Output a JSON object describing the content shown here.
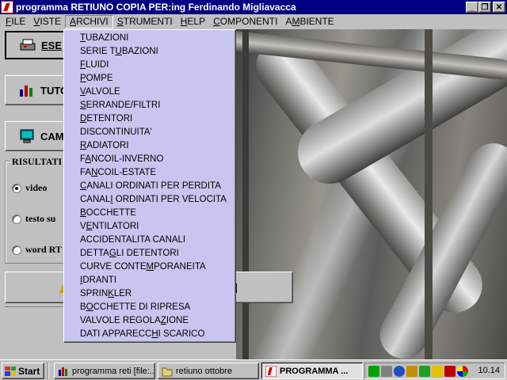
{
  "window": {
    "title": "programma RETIUNO COPIA PER:ing Ferdinando Migliavacca",
    "minimize_label": "_",
    "restore_label": "❐",
    "close_label": "✕"
  },
  "menubar": [
    {
      "label": "FILE",
      "mnemonic": "F",
      "rest": "ILE"
    },
    {
      "label": "VISTE",
      "mnemonic": "V",
      "rest": "ISTE"
    },
    {
      "label": "ARCHIVI",
      "mnemonic": "A",
      "rest": "RCHIVI"
    },
    {
      "label": "STRUMENTI",
      "mnemonic": "S",
      "rest": "TRUMENTI"
    },
    {
      "label": "HELP",
      "mnemonic": "H",
      "rest": "ELP"
    },
    {
      "label": "COMPONENTI",
      "mnemonic": "C",
      "rest": "OMPONENTI"
    },
    {
      "label": "AMBIENTE",
      "mnemonic": "M",
      "pre": "A",
      "rest": "BIENTE"
    }
  ],
  "active_menu": "ARCHIVI",
  "archivi_menu": [
    {
      "pre": "",
      "u": "T",
      "post": "UBAZIONI"
    },
    {
      "pre": "SERIE T",
      "u": "U",
      "post": "BAZIONI"
    },
    {
      "pre": "",
      "u": "F",
      "post": "LUIDI"
    },
    {
      "pre": "",
      "u": "P",
      "post": "OMPE"
    },
    {
      "pre": "",
      "u": "V",
      "post": "ALVOLE"
    },
    {
      "pre": "",
      "u": "S",
      "post": "ERRANDE/FILTRI"
    },
    {
      "pre": "",
      "u": "D",
      "post": "ETENTORI"
    },
    {
      "pre": "DISCONTINUITA'",
      "u": "",
      "post": ""
    },
    {
      "pre": "",
      "u": "R",
      "post": "ADIATORI"
    },
    {
      "pre": "F",
      "u": "A",
      "post": "NCOIL-INVERNO"
    },
    {
      "pre": "FA",
      "u": "N",
      "post": "COIL-ESTATE"
    },
    {
      "pre": "",
      "u": "C",
      "post": "ANALI ORDINATI PER PERDITA"
    },
    {
      "pre": "CANAL",
      "u": "I",
      "post": " ORDINATI PER VELOCITA"
    },
    {
      "pre": "",
      "u": "B",
      "post": "OCCHETTE"
    },
    {
      "pre": "V",
      "u": "E",
      "post": "NTILATORI"
    },
    {
      "pre": "ACCIDENTALITA CANALI",
      "u": "",
      "post": ""
    },
    {
      "pre": "DETTA",
      "u": "G",
      "post": "LI DETENTORI"
    },
    {
      "pre": "CURVE CONTE",
      "u": "M",
      "post": "PORANEITA"
    },
    {
      "pre": "",
      "u": "I",
      "post": "DRANTI"
    },
    {
      "pre": "SPRIN",
      "u": "K",
      "post": "LER"
    },
    {
      "pre": "B",
      "u": "O",
      "post": "CCHETTE DI RIPRESA"
    },
    {
      "pre": "VALVOLE REGOLA",
      "u": "Z",
      "post": "IONE"
    },
    {
      "pre": "DATI APPARECC",
      "u": "H",
      "post": "I SCARICO"
    }
  ],
  "left_panel": {
    "esegui_label": "ESE",
    "tutorial_label": "TUTO",
    "cambia_label": "CAM",
    "group_title": "RISULTATI",
    "radios": [
      {
        "label": "video",
        "checked": true
      },
      {
        "label": "testo su",
        "checked": false
      },
      {
        "label": "word RT",
        "checked": false
      }
    ]
  },
  "taskbar": {
    "start_label": "Start",
    "tasks": [
      {
        "label": "programma reti [file:...",
        "pressed": false
      },
      {
        "label": "retiuno ottobre",
        "pressed": false
      },
      {
        "label": "PROGRAMMA ...",
        "pressed": true
      }
    ],
    "clock": "10.14"
  },
  "colors": {
    "title_bar": "#000080",
    "menu_bg": "#c0c0c0",
    "dropdown_bg": "#c8c6f0"
  }
}
